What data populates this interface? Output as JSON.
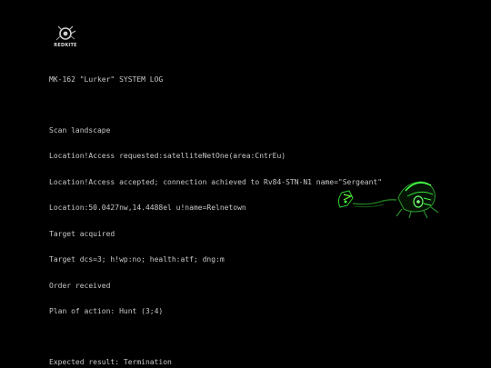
{
  "logo": {
    "text": "REDKITE",
    "icon": "redkite-logo-icon"
  },
  "log": {
    "title": "MK-162 \"Lurker\" SYSTEM LOG",
    "lines": [
      "Scan landscape",
      "Location!Access requested:satelliteNetOne(area:CntrEu)",
      "Location!Access accepted; connection achieved to Rv84-STN-N1 name=\"Sergeant\"",
      "Location:50.0427nw,14.4488el u!name=Relnetown",
      "Target acquired",
      "Target dcs=3; h!wp:no; health:atf; dng:m",
      "Order received",
      "Plan of action: Hunt (3;4)"
    ],
    "result": "Expected result: Termination"
  },
  "creature": {
    "icon": "lurker-robot-icon",
    "glow_color": "#33ff33"
  }
}
